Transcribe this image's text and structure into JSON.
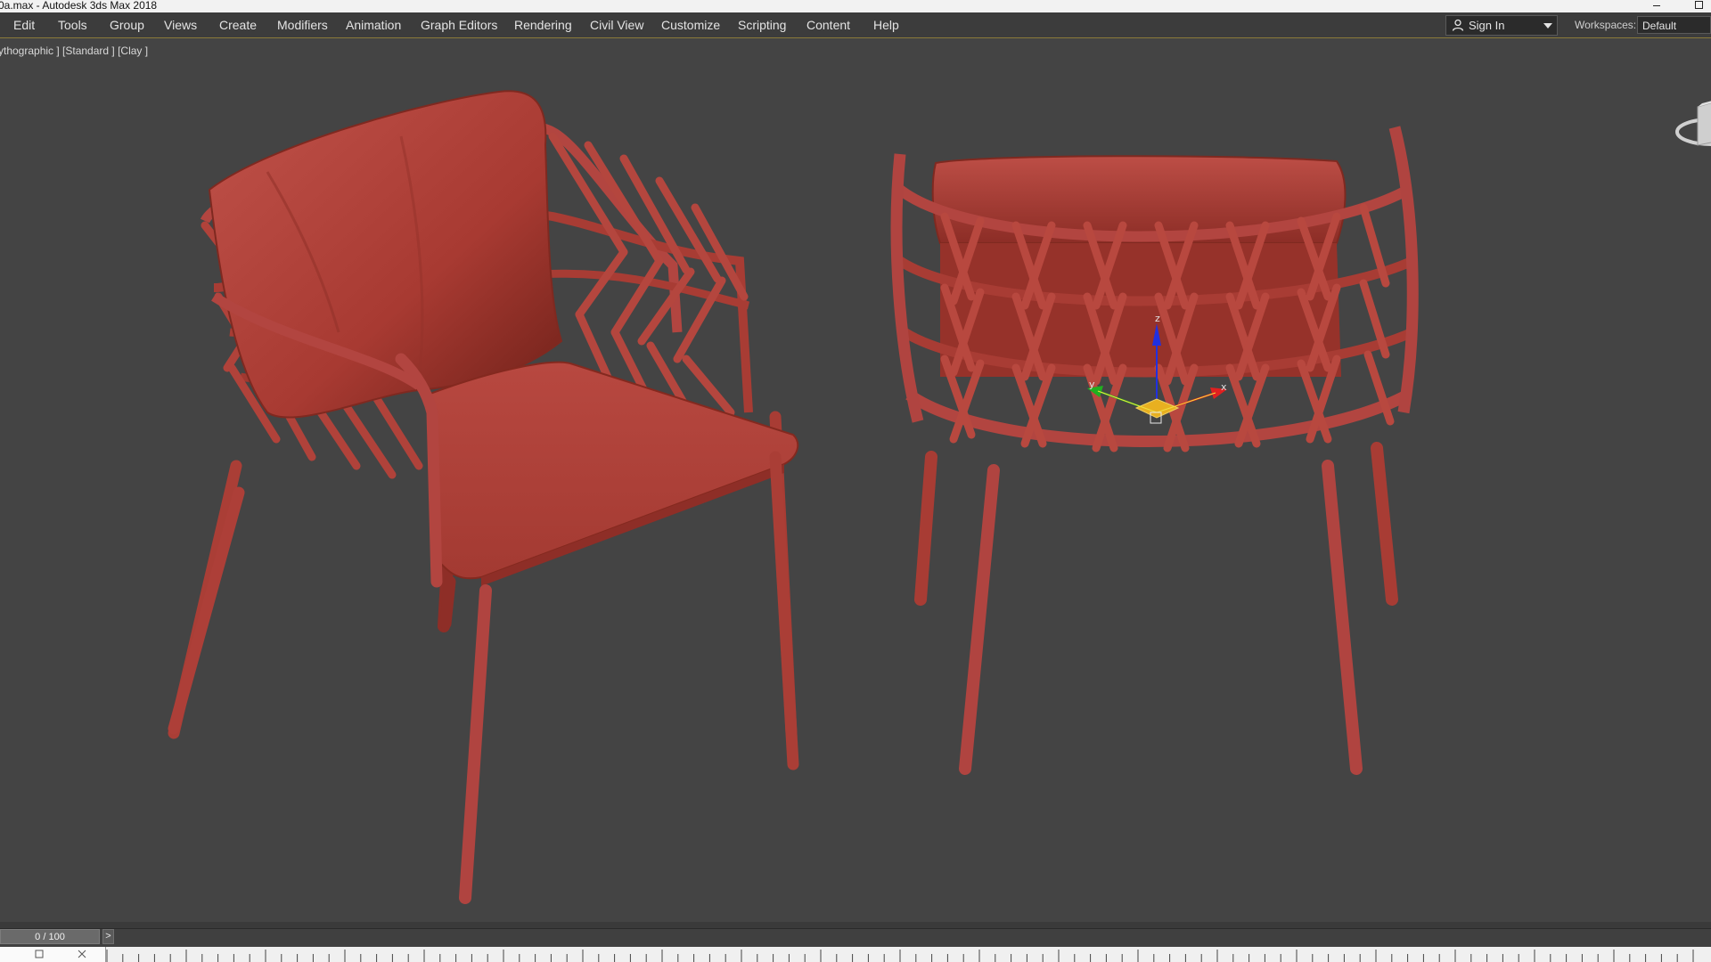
{
  "window": {
    "title": "0a.max - Autodesk 3ds Max 2018"
  },
  "menubar": {
    "items": [
      {
        "label": "Edit"
      },
      {
        "label": "Tools"
      },
      {
        "label": "Group"
      },
      {
        "label": "Views"
      },
      {
        "label": "Create"
      },
      {
        "label": "Modifiers"
      },
      {
        "label": "Animation"
      },
      {
        "label": "Graph Editors"
      },
      {
        "label": "Rendering"
      },
      {
        "label": "Civil View"
      },
      {
        "label": "Customize"
      },
      {
        "label": "Scripting"
      },
      {
        "label": "Content"
      },
      {
        "label": "Help"
      }
    ],
    "sign_in": {
      "label": "Sign In",
      "icon": "user-icon"
    },
    "workspaces": {
      "label": "Workspaces:",
      "value": "Default"
    }
  },
  "viewport": {
    "label": "ythographic ] [Standard ] [Clay ]",
    "shading": "Clay",
    "model_color": "#b0433a",
    "background_color": "#444444",
    "gizmo_axes": [
      "x",
      "y",
      "z"
    ]
  },
  "timeline": {
    "frame_display": "0 / 100",
    "next_label": ">"
  },
  "colors": {
    "menu_bg": "#3c3c3c",
    "viewport_bg": "#444444",
    "clay": "#b0433a",
    "axis_x": "#e02020",
    "axis_y": "#20b020",
    "axis_z": "#2030e0"
  }
}
